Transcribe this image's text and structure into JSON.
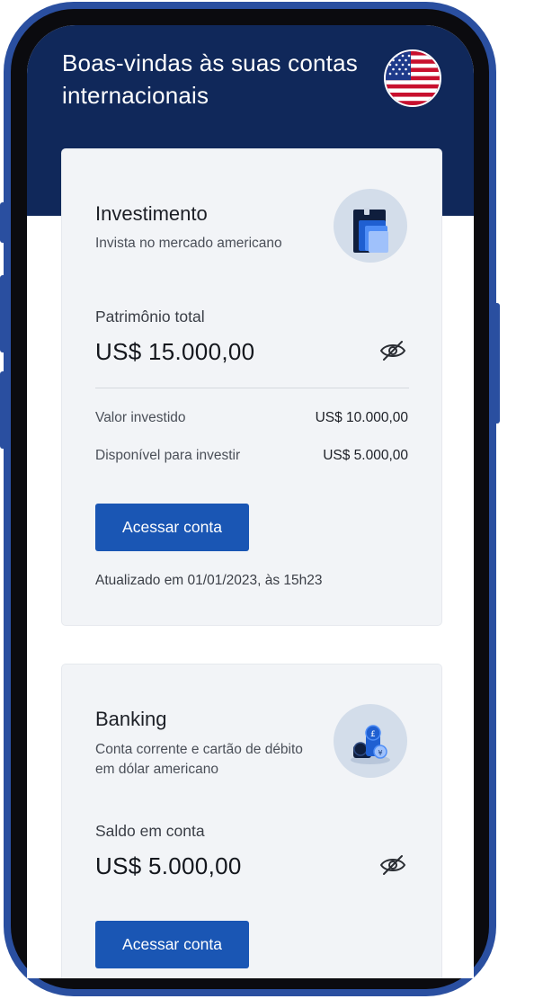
{
  "header": {
    "title": "Boas-vindas às suas contas internacionais",
    "flag_icon": "us-flag-icon"
  },
  "investimento": {
    "title": "Investimento",
    "subtitle": "Invista no mercado americano",
    "illustration_icon": "documents-illustration-icon",
    "total_label": "Patrimônio total",
    "total_value": "US$ 15.000,00",
    "eye_icon": "eye-off-icon",
    "rows": [
      {
        "label": "Valor investido",
        "value": "US$ 10.000,00"
      },
      {
        "label": "Disponível para investir",
        "value": "US$ 5.000,00"
      }
    ],
    "button_label": "Acessar conta",
    "updated_text": "Atualizado em 01/01/2023, às 15h23"
  },
  "banking": {
    "title": "Banking",
    "subtitle": "Conta corrente e cartão de débito em dólar americano",
    "illustration_icon": "coins-illustration-icon",
    "balance_label": "Saldo em conta",
    "balance_value": "US$ 5.000,00",
    "eye_icon": "eye-off-icon",
    "button_label": "Acessar conta"
  },
  "colors": {
    "header_bg": "#10285a",
    "button_bg": "#1a56b4",
    "card_bg": "#f2f4f7",
    "frame": "#2a4fa0"
  }
}
